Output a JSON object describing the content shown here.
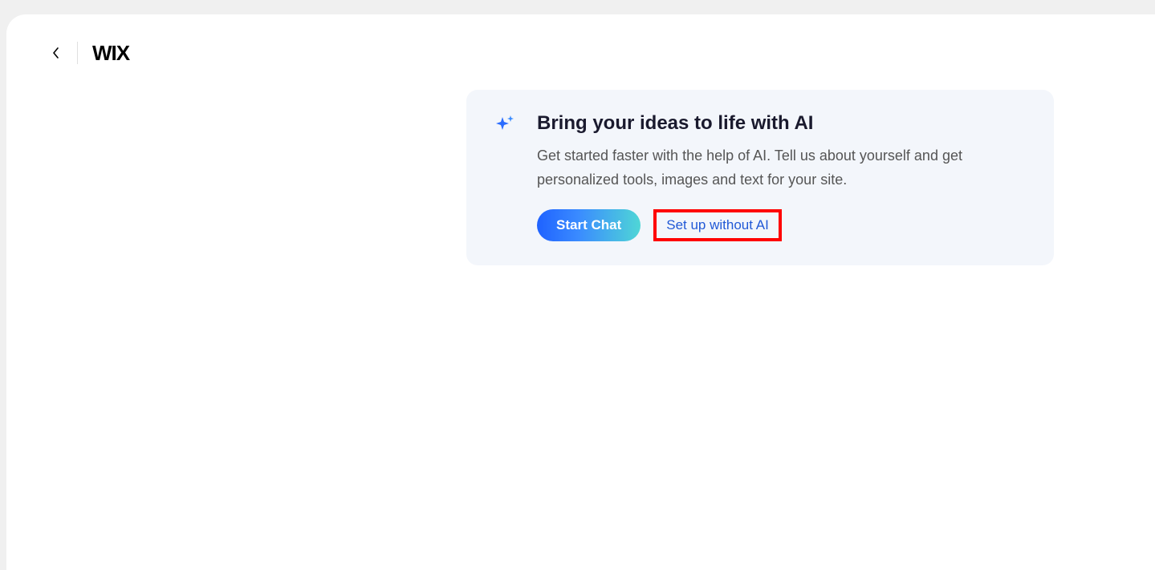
{
  "logo": "WIX",
  "card": {
    "title": "Bring your ideas to life with AI",
    "description": "Get started faster with the help of AI. Tell us about yourself and get personalized tools, images and text for your site.",
    "primary_button": "Start Chat",
    "secondary_link": "Set up without AI"
  }
}
